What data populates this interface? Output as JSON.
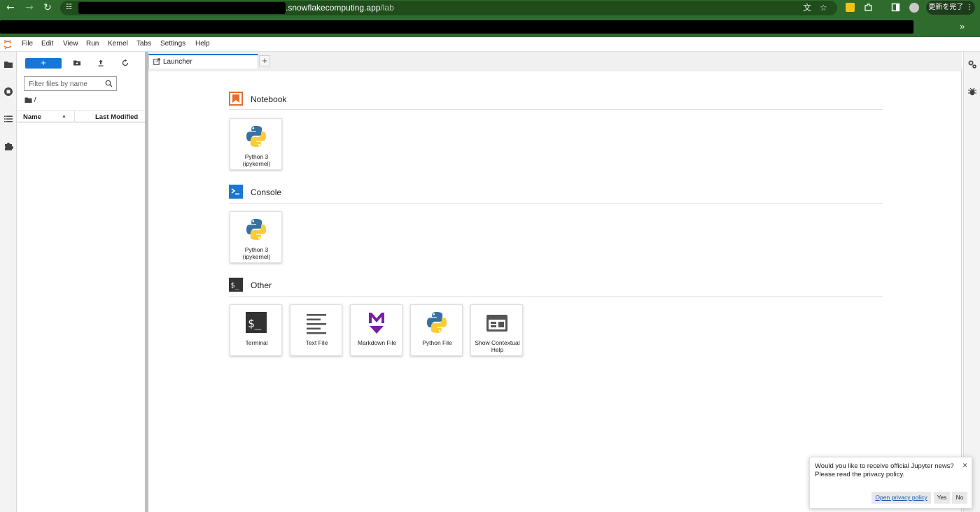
{
  "browser": {
    "back_icon": "arrow-left-icon",
    "url_visible": ".snowflakecomputing.app",
    "url_path": "/lab",
    "update_label": "更新を完了 ⋮",
    "bookmarks_more": "»"
  },
  "menubar": {
    "items": [
      "File",
      "Edit",
      "View",
      "Run",
      "Kernel",
      "Tabs",
      "Settings",
      "Help"
    ]
  },
  "filebrowser": {
    "new_label": "+",
    "filter_placeholder": "Filter files by name",
    "breadcrumb": "/",
    "col_name": "Name",
    "col_modified": "Last Modified"
  },
  "tabs": {
    "active_label": "Launcher",
    "add_label": "+"
  },
  "launcher": {
    "notebook": {
      "title": "Notebook",
      "cards": [
        {
          "label": "Python 3 (ipykernel)",
          "icon": "python-icon"
        }
      ]
    },
    "console": {
      "title": "Console",
      "cards": [
        {
          "label": "Python 3 (ipykernel)",
          "icon": "python-icon"
        }
      ]
    },
    "other": {
      "title": "Other",
      "cards": [
        {
          "label": "Terminal",
          "icon": "terminal-icon"
        },
        {
          "label": "Text File",
          "icon": "text-file-icon"
        },
        {
          "label": "Markdown File",
          "icon": "markdown-icon"
        },
        {
          "label": "Python File",
          "icon": "python-icon"
        },
        {
          "label": "Show Contextual Help",
          "icon": "contextual-help-icon"
        }
      ]
    }
  },
  "notification": {
    "message_line1": "Would you like to receive official Jupyter news?",
    "message_line2": "Please read the privacy policy.",
    "close": "×",
    "open_privacy": "Open privacy policy",
    "yes": "Yes",
    "no": "No"
  },
  "colors": {
    "accent": "#1976d2",
    "browser_green": "#2f6b2c",
    "notebook_orange": "#e46e2e",
    "markdown_purple": "#7b1fa2"
  }
}
